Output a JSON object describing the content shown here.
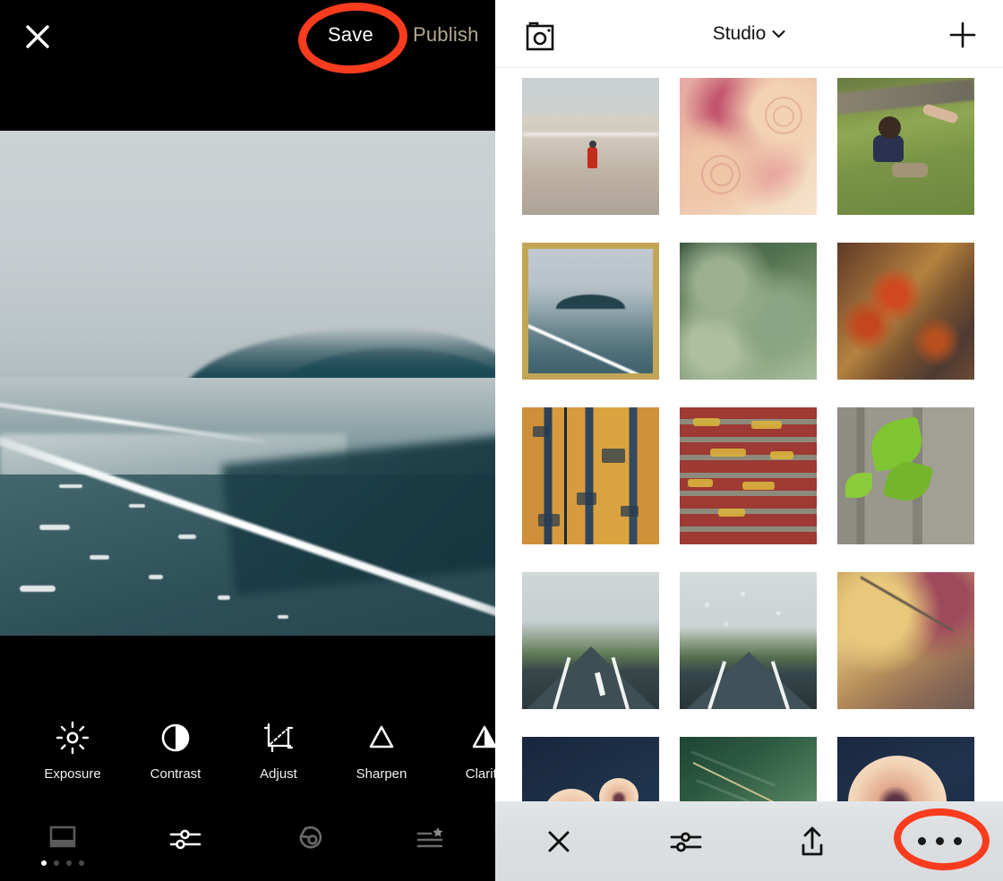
{
  "editor": {
    "topbar": {
      "close_icon": "close-x-icon",
      "save_label": "Save",
      "publish_label": "Publish",
      "save_color": "#ffffff",
      "publish_color": "#b3a992"
    },
    "preview": {
      "name": "coastal-seascape-photo",
      "description": "Misty coastline with foggy headland and white surf line across dark teal water"
    },
    "tools": [
      {
        "label": "Exposure",
        "icon": "sun-brightness-icon"
      },
      {
        "label": "Contrast",
        "icon": "half-circle-contrast-icon"
      },
      {
        "label": "Adjust",
        "icon": "crop-rotate-icon"
      },
      {
        "label": "Sharpen",
        "icon": "triangle-outline-icon"
      },
      {
        "label": "Clarity",
        "icon": "triangle-split-icon"
      }
    ],
    "nav": [
      {
        "name": "presets",
        "icon": "filmstrip-presets-icon"
      },
      {
        "name": "edit-tools",
        "icon": "sliders-icon"
      },
      {
        "name": "undo-history",
        "icon": "undo-circle-icon"
      },
      {
        "name": "recipes",
        "icon": "list-star-icon"
      }
    ],
    "preset_pages": {
      "count": 4,
      "active_index": 0
    }
  },
  "library": {
    "header": {
      "camera_icon": "camera-icon",
      "title": "Studio",
      "chevron_icon": "chevron-down-icon",
      "add_icon": "plus-icon"
    },
    "grid": {
      "columns": 3,
      "selection_color": "#c2a557",
      "selected_index": 3,
      "tiles": [
        {
          "name": "child-in-red-on-beach",
          "art": "art-beachkid",
          "selected": false
        },
        {
          "name": "peach-pink-roses",
          "art": "art-roses",
          "selected": false
        },
        {
          "name": "toddler-on-grass",
          "art": "art-toddler",
          "selected": false
        },
        {
          "name": "misty-seascape",
          "art": "art-seascape",
          "selected": true
        },
        {
          "name": "green-hydrangea-leaves",
          "art": "art-hydrangea",
          "selected": false
        },
        {
          "name": "rusted-metal-texture",
          "art": "art-rust",
          "selected": false
        },
        {
          "name": "peeling-paint-wall",
          "art": "art-paint",
          "selected": false
        },
        {
          "name": "yellow-lichen-brick",
          "art": "art-brick",
          "selected": false
        },
        {
          "name": "ivy-leaf-on-fence",
          "art": "art-ivy",
          "selected": false
        },
        {
          "name": "foggy-country-road",
          "art": "art-road1",
          "selected": false
        },
        {
          "name": "rainy-road-windshield",
          "art": "art-road2",
          "selected": false
        },
        {
          "name": "lichen-covered-branch",
          "art": "art-lichen",
          "selected": false
        },
        {
          "name": "cream-dahlias-dark",
          "art": "art-dahlia",
          "selected": false
        },
        {
          "name": "green-fern-fronds",
          "art": "art-fern",
          "selected": false
        },
        {
          "name": "single-cream-dahlia",
          "art": "art-dahlia2",
          "selected": false
        }
      ]
    },
    "toolbar": {
      "background": "#dee1e3",
      "buttons": [
        {
          "name": "close",
          "icon": "close-x-icon"
        },
        {
          "name": "edit",
          "icon": "sliders-icon"
        },
        {
          "name": "share",
          "icon": "upload-share-icon"
        },
        {
          "name": "more",
          "icon": "ellipsis-more-icon"
        }
      ]
    }
  },
  "annotations": {
    "color": "#fa3c1e",
    "marks": [
      {
        "name": "annotation-circle-save",
        "target": "Save"
      },
      {
        "name": "annotation-circle-more",
        "target": "more"
      }
    ]
  }
}
